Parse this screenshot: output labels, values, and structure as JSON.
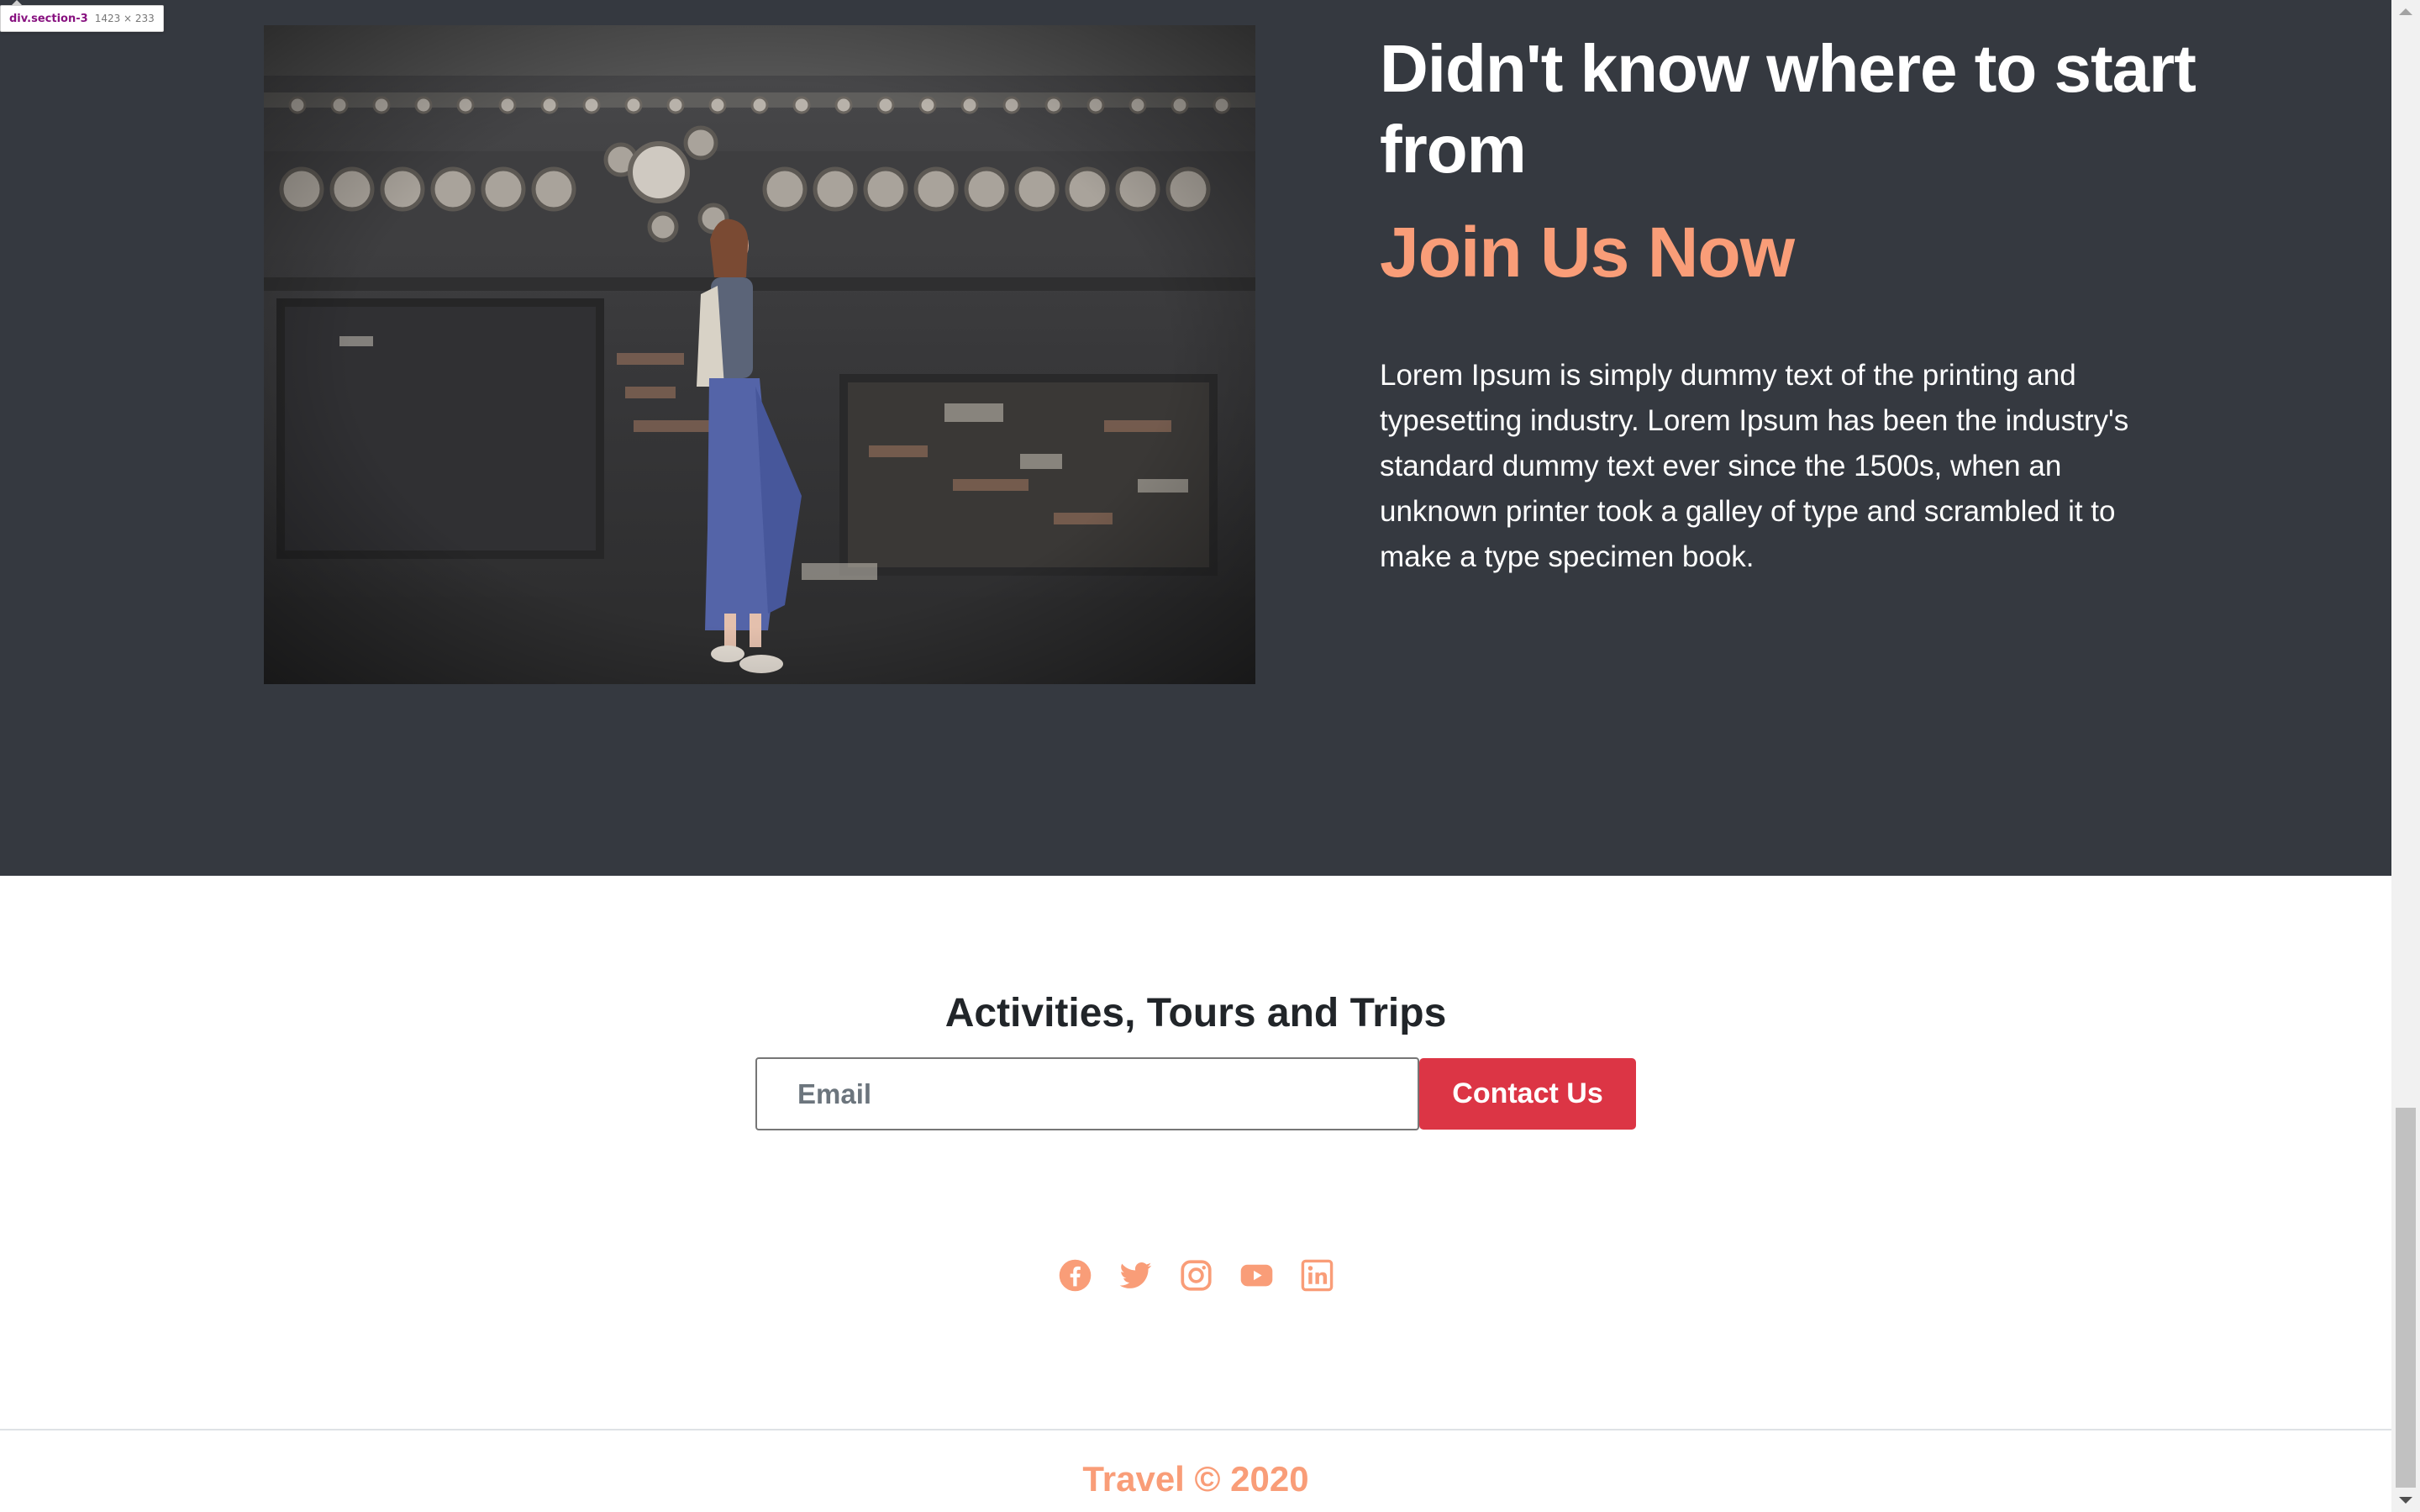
{
  "inspector": {
    "tag": "div.section-3",
    "dims": "1423 × 233"
  },
  "hero": {
    "image_icon": "photo-woman-against-ornate-wall",
    "title": "Didn't know where to start from",
    "accent": "Join Us Now",
    "body": "Lorem Ipsum is simply dummy text of the printing and typesetting industry. Lorem Ipsum has been the industry's standard dummy text ever since the 1500s, when an unknown printer took a galley of type and scrambled it to make a type specimen book."
  },
  "subscribe": {
    "title": "Activities, Tours and Trips",
    "email_placeholder": "Email",
    "email_value": "",
    "button_label": "Contact Us"
  },
  "social": [
    {
      "icon": "facebook-icon"
    },
    {
      "icon": "twitter-icon"
    },
    {
      "icon": "instagram-icon"
    },
    {
      "icon": "youtube-icon"
    },
    {
      "icon": "linkedin-icon"
    }
  ],
  "footer": {
    "text": "Travel © 2020"
  },
  "colors": {
    "dark_bg": "#353940",
    "accent": "#f99d78",
    "button": "#dc3545",
    "heading": "#212529"
  }
}
